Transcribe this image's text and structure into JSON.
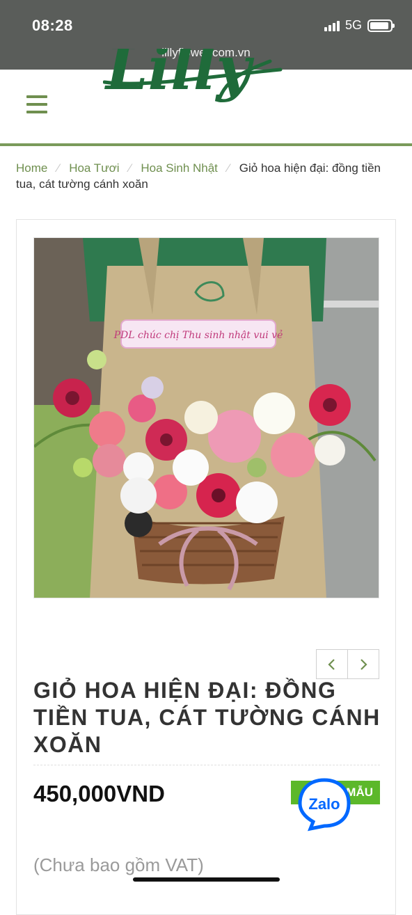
{
  "status_bar": {
    "time": "08:28",
    "network": "5G",
    "url": "lillyflower.com.vn"
  },
  "header": {
    "menu_icon": "hamburger-icon",
    "logo_text": "Lilly"
  },
  "breadcrumb": {
    "items": [
      "Home",
      "Hoa Tươi",
      "Hoa Sinh Nhật"
    ],
    "current": "Giỏ hoa hiện đại: đồng tiền tua, cát tường cánh xoăn",
    "separator": "⁄"
  },
  "product": {
    "card_text": "PDL chúc chị Thu sinh nhật vui vẻ",
    "title": "GIỎ HOA HIỆN ĐẠI: ĐỒNG TIỀN TUA, CÁT TƯỜNG CÁNH XOĂN",
    "price": "450,000VND",
    "badge_label": "MẪU",
    "vat_note": "(Chưa bao gồm VAT)"
  },
  "gallery": {
    "prev_icon": "chevron-left-icon",
    "next_icon": "chevron-right-icon"
  },
  "chat": {
    "zalo_label": "Zalo"
  },
  "colors": {
    "brand_green": "#6f8f4f",
    "badge_green": "#5cb82a",
    "zalo_blue": "#0068ff",
    "status_bar": "#5a5d5a"
  }
}
